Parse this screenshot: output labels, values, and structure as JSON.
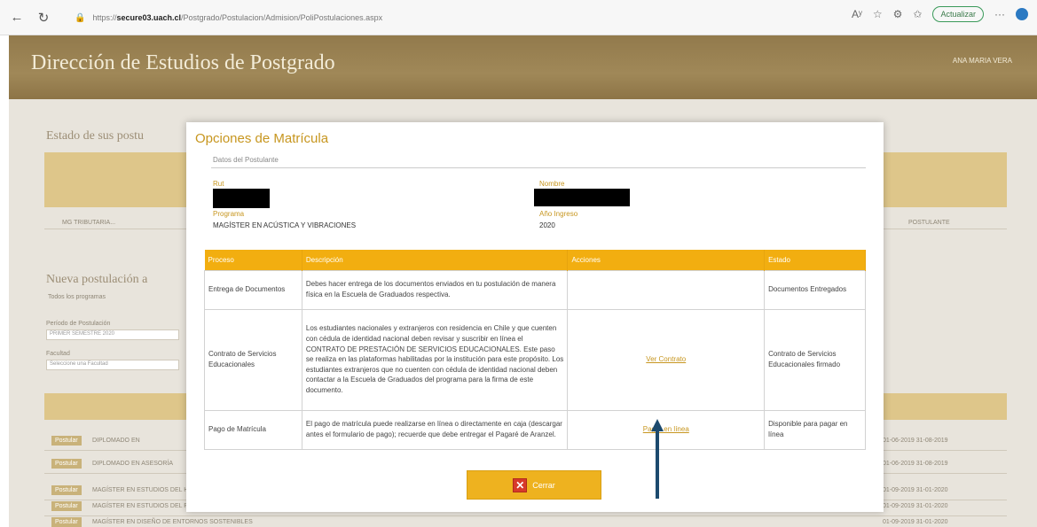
{
  "browser": {
    "url_prefix": "https://",
    "url_host": "secure03.uach.cl",
    "url_path": "/Postgrado/Postulacion/Admision/PoliPostulaciones.aspx",
    "read_aloud": "Aʸ",
    "update_label": "Actualizar"
  },
  "app": {
    "title": "Dirección de Estudios de Postgrado",
    "user": "ANA MARIA VERA"
  },
  "background": {
    "section1_title": "Estado de sus postu",
    "row1_text": "MG TRIBUTARIA...",
    "row1_status": "POSTULANTE",
    "section2_title": "Nueva postulación a",
    "section2_hint": "Todos los programas",
    "select1_label": "Período de Postulación",
    "select1_value": "PRIMER SEMESTRE 2020",
    "select2_label": "Facultad",
    "select2_value": "Seleccione una Facultad",
    "programs": [
      {
        "btn": "Postular",
        "name": "DIPLOMADO EN",
        "dates": "01-06-2019  31-08-2019"
      },
      {
        "btn": "Postular",
        "name": "DIPLOMADO EN ASESORÍA",
        "dates": "01-06-2019  31-08-2019"
      },
      {
        "btn": "Postular",
        "name": "MAGÍSTER EN ESTUDIOS DEL HÁBITAT",
        "dates": "01-09-2019  31-01-2020"
      },
      {
        "btn": "Postular",
        "name": "MAGÍSTER EN ESTUDIOS DEL PATRIMONIO",
        "dates": "01-09-2019  31-01-2020"
      },
      {
        "btn": "Postular",
        "name": "MAGÍSTER EN DISEÑO DE ENTORNOS SOSTENIBLES",
        "dates": "01-09-2019  31-01-2020"
      }
    ]
  },
  "modal": {
    "title": "Opciones de Matrícula",
    "section": "Datos del Postulante",
    "rut_label": "Rut",
    "nombre_label": "Nombre",
    "programa_label": "Programa",
    "programa_value": "MAGÍSTER EN ACÚSTICA Y VIBRACIONES",
    "anio_label": "Año Ingreso",
    "anio_value": "2020",
    "table": {
      "headers": [
        "Proceso",
        "Descripción",
        "Acciones",
        "Estado"
      ],
      "rows": [
        {
          "proceso": "Entrega de Documentos",
          "descripcion": "Debes hacer entrega de los documentos enviados en tu postulación de manera física en la Escuela de Graduados respectiva.",
          "accion": "",
          "estado": "Documentos Entregados"
        },
        {
          "proceso": "Contrato de Servicios Educacionales",
          "descripcion": "Los estudiantes nacionales y extranjeros con residencia en Chile y que cuenten con cédula de identidad nacional deben revisar y suscribir en línea el CONTRATO DE PRESTACIÓN DE SERVICIOS EDUCACIONALES. Este paso se realiza en las plataformas habilitadas por la institución para este propósito. Los estudiantes extranjeros que no cuenten con cédula de identidad nacional deben contactar a la Escuela de Graduados del programa para la firma de este documento.",
          "accion": "Ver Contrato",
          "estado": "Contrato de Servicios Educacionales firmado"
        },
        {
          "proceso": "Pago de Matrícula",
          "descripcion": "El pago de matrícula puede realizarse en línea o directamente en caja (descargar antes el formulario de pago); recuerde que debe entregar el Pagaré de Aranzel.",
          "accion": "Pagar en línea",
          "estado": "Disponible para pagar en línea"
        }
      ]
    },
    "close_label": "Cerrar"
  },
  "colors": {
    "accent": "#f2ae10",
    "header": "#a08858",
    "link": "#c7961f",
    "arrow": "#1c4a6e"
  }
}
